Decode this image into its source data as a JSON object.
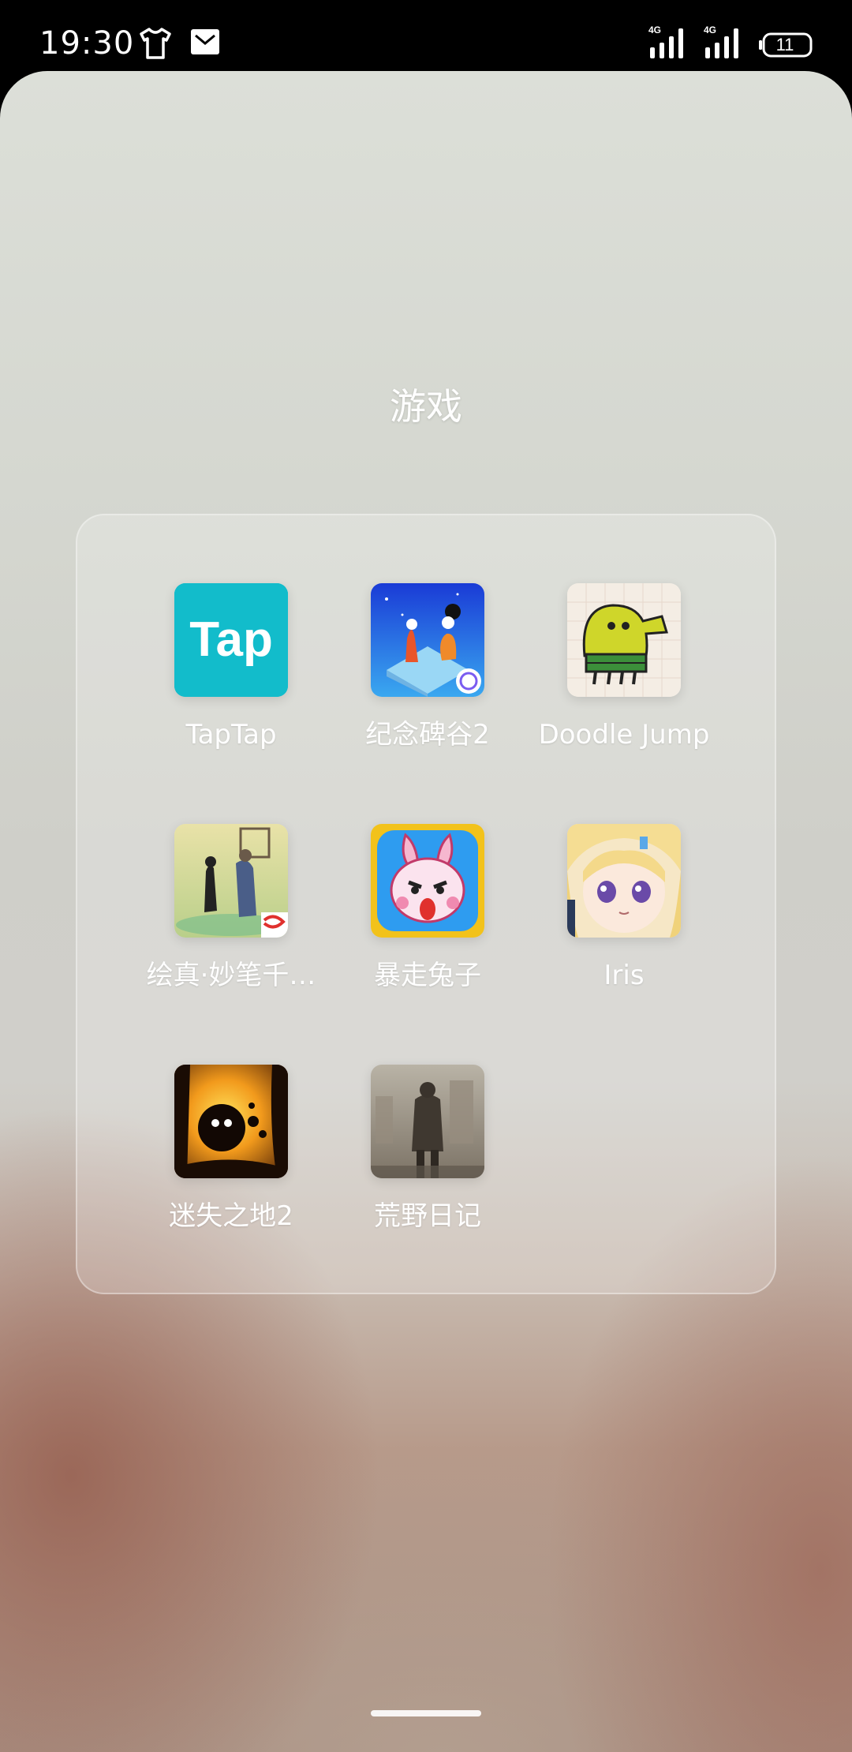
{
  "status_bar": {
    "time": "19:30",
    "battery": "11",
    "network_1": "4G",
    "network_2": "4G",
    "icons": [
      "tshirt-icon",
      "mail-icon",
      "signal-icon",
      "signal-icon",
      "battery-icon"
    ]
  },
  "folder": {
    "title": "游戏",
    "apps": [
      {
        "label": "TapTap",
        "icon": "taptap-icon",
        "icon_text": "Tap"
      },
      {
        "label": "纪念碑谷2",
        "icon": "monument-valley-2-icon"
      },
      {
        "label": "Doodle Jump",
        "icon": "doodle-jump-icon"
      },
      {
        "label": "绘真·妙笔千…",
        "icon": "huizhen-icon"
      },
      {
        "label": "暴走兔子",
        "icon": "rampage-rabbit-icon"
      },
      {
        "label": "Iris",
        "icon": "iris-icon"
      },
      {
        "label": "迷失之地2",
        "icon": "badland-2-icon"
      },
      {
        "label": "荒野日记",
        "icon": "wilderness-diary-icon"
      }
    ]
  },
  "colors": {
    "taptap": "#12bccb",
    "status_bar_bg": "#000000",
    "label": "#ffffff"
  }
}
